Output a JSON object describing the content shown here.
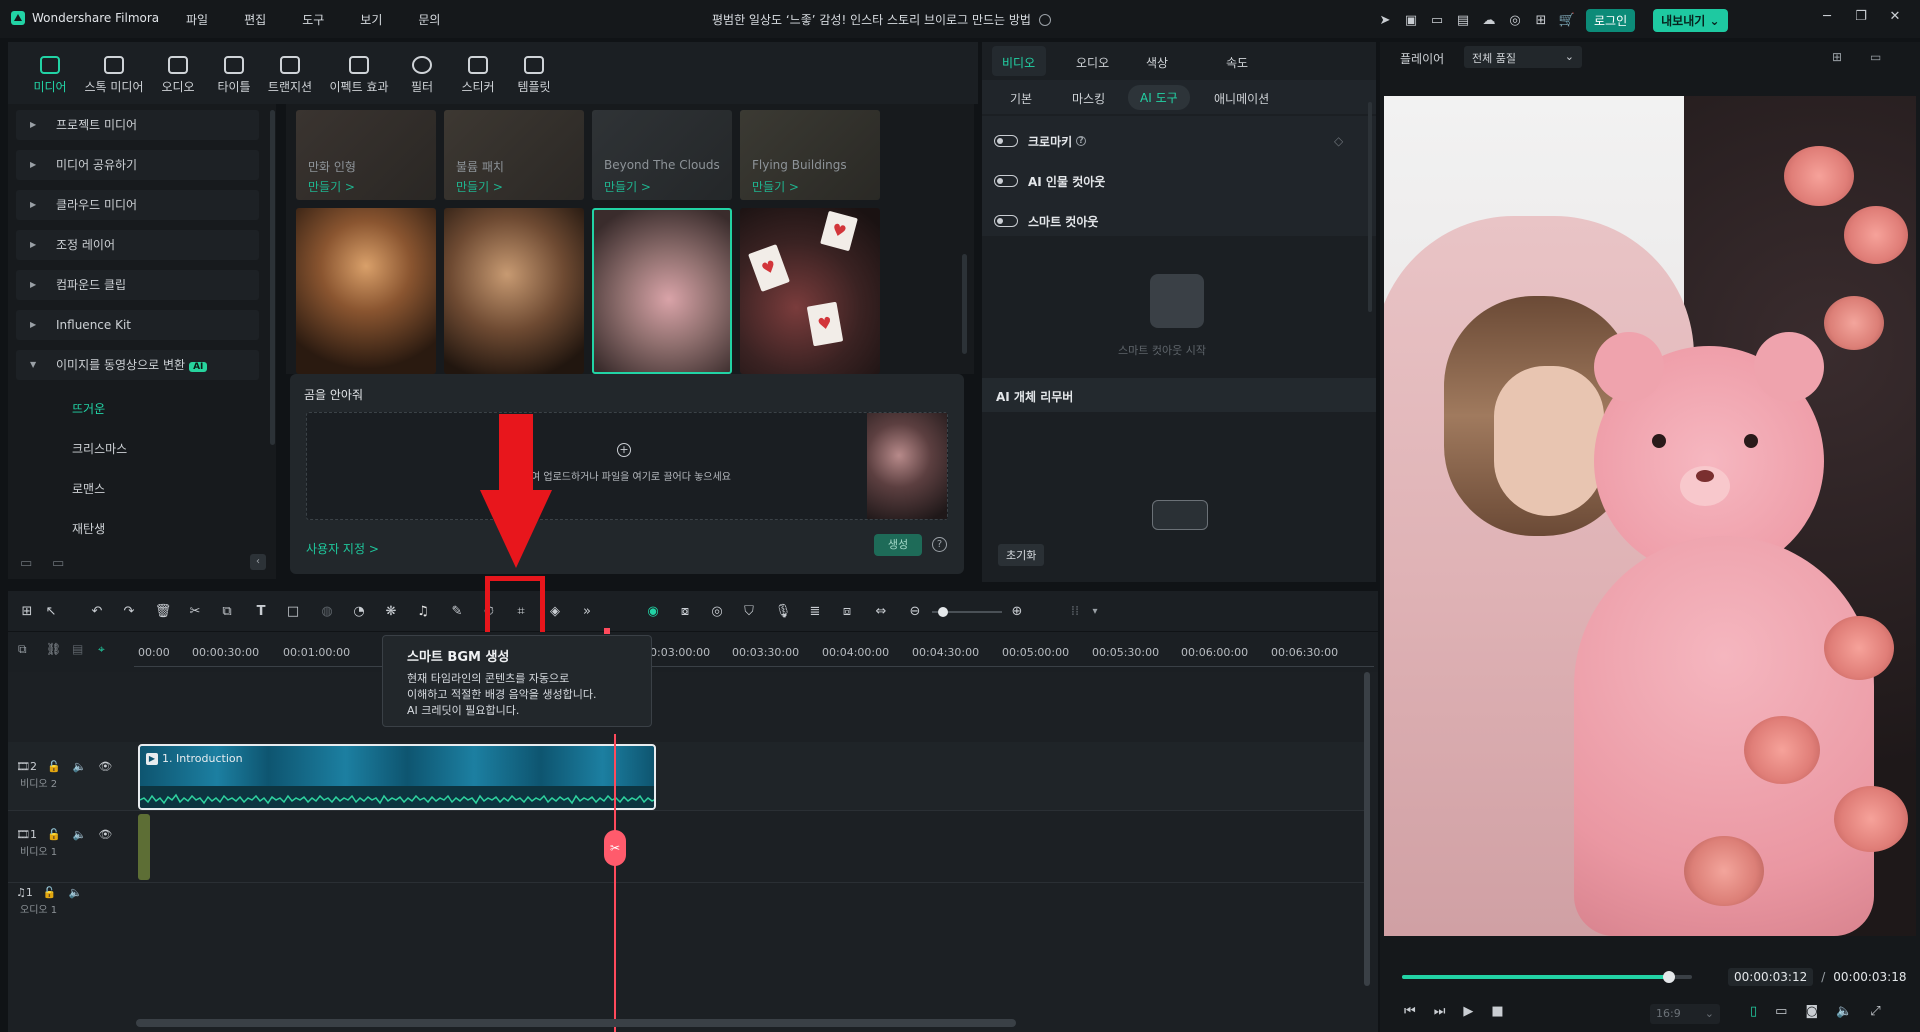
{
  "titlebar": {
    "app_name": "Wondershare Filmora",
    "menu": [
      "파일",
      "편집",
      "도구",
      "보기",
      "문의"
    ],
    "project_title": "평범한 일상도 ‘느좋’ 감성! 인스타 스토리 브이로그 만드는 방법",
    "login_label": "로그인",
    "export_label": "내보내기"
  },
  "media_tabs": [
    "미디어",
    "스톡 미디어",
    "오디오",
    "타이틀",
    "트랜지션",
    "이펙트 효과",
    "필터",
    "스티커",
    "템플릿"
  ],
  "sidebar": {
    "items": [
      "프로젝트 미디어",
      "미디어 공유하기",
      "클라우드 미디어",
      "조정 레이어",
      "컴파운드 클립",
      "Influence Kit",
      "이미지를 동영상으로 변환"
    ],
    "ai_badge": "AI",
    "subitems": [
      "뜨거운",
      "크리스마스",
      "로맨스",
      "재탄생"
    ]
  },
  "templates": {
    "row1": [
      {
        "title": "만화 인형",
        "action": "만들기 >"
      },
      {
        "title": "불륨 패치",
        "action": "만들기 >"
      },
      {
        "title": "Beyond The Clouds",
        "action": "만들기 >"
      },
      {
        "title": "Flying Buildings",
        "action": "만들기 >"
      }
    ]
  },
  "generate_panel": {
    "title": "곰을 안아줘",
    "drop_text": "여 업로드하거나 파일을 여기로 끌어다 놓으세요",
    "custom_link": "사용자 지정 >",
    "generate_label": "생성",
    "help_icon": "?"
  },
  "properties": {
    "tabs": [
      "비디오",
      "오디오",
      "색상",
      "속도"
    ],
    "subtabs": [
      "기본",
      "마스킹",
      "AI 도구",
      "애니메이션"
    ],
    "toggles": [
      "크로마키",
      "AI 인물 컷아웃",
      "스마트 컷아웃"
    ],
    "smart_cutout_start": "스마트 컷아웃 시작",
    "object_remover": "AI 개체 리무버",
    "reset_label": "초기화"
  },
  "player": {
    "label": "플레이어",
    "quality": "전체 품질",
    "current_time": "00:00:03:12",
    "separator": "/",
    "total_time": "00:00:03:18",
    "aspect": "16:9",
    "progress": 0.92
  },
  "timeline": {
    "ruler": [
      "00:00",
      "00:00:30:00",
      "00:01:00:00",
      "00:03:00:00",
      "00:03:30:00",
      "00:04:00:00",
      "00:04:30:00",
      "00:05:00:00",
      "00:05:30:00",
      "00:06:00:00",
      "00:06:30:00"
    ],
    "tooltip": {
      "title": "스마트 BGM 생성",
      "body": [
        "현재 타임라인의 콘텐츠를 자동으로",
        "이해하고 적절한 배경 음악을 생성합니다.",
        "AI 크레딧이 필요합니다."
      ]
    },
    "tracks": [
      {
        "num": "2",
        "label": "비디오 2"
      },
      {
        "num": "1",
        "label": "비디오 1"
      },
      {
        "num": "1",
        "label": "오디오 1"
      }
    ],
    "clip_label": "1. Introduction"
  }
}
